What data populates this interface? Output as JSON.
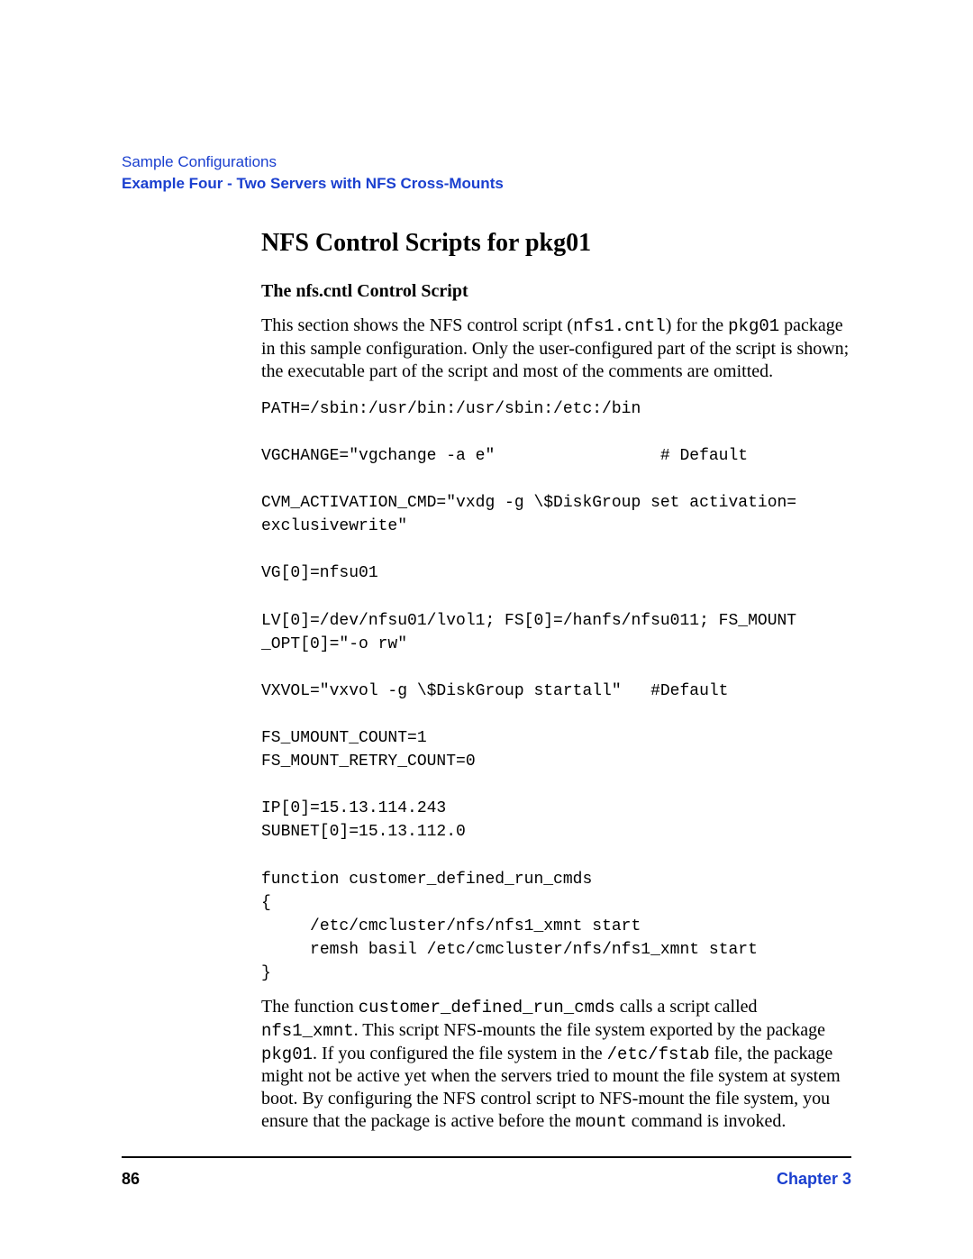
{
  "header": {
    "breadcrumb": "Sample Configurations",
    "title": "Example Four - Two Servers with NFS Cross-Mounts"
  },
  "section": {
    "heading": "NFS Control Scripts for pkg01",
    "subheading": "The nfs.cntl Control Script",
    "intro_pre": "This section shows the NFS control script (",
    "intro_code1": "nfs1.cntl",
    "intro_mid": ") for the ",
    "intro_code2": "pkg01",
    "intro_post": " package in this sample configuration. Only the user-configured part of the script is shown; the executable part of the script and most of the comments are omitted."
  },
  "code": "PATH=/sbin:/usr/bin:/usr/sbin:/etc:/bin\n\nVGCHANGE=\"vgchange -a e\"                 # Default\n\nCVM_ACTIVATION_CMD=\"vxdg -g \\$DiskGroup set activation=\nexclusivewrite\"\n\nVG[0]=nfsu01\n\nLV[0]=/dev/nfsu01/lvol1; FS[0]=/hanfs/nfsu011; FS_MOUNT\n_OPT[0]=\"-o rw\"\n\nVXVOL=\"vxvol -g \\$DiskGroup startall\"   #Default\n\nFS_UMOUNT_COUNT=1\nFS_MOUNT_RETRY_COUNT=0\n\nIP[0]=15.13.114.243\nSUBNET[0]=15.13.112.0\n\nfunction customer_defined_run_cmds\n{\n     /etc/cmcluster/nfs/nfs1_xmnt start\n     remsh basil /etc/cmcluster/nfs/nfs1_xmnt start\n}",
  "closing": {
    "p1_pre": "The function ",
    "p1_code1": "customer_defined_run_cmds",
    "p1_mid1": " calls a script called ",
    "p1_code2": "nfs1_xmnt",
    "p1_mid2": ". This script NFS-mounts the file system exported by the package ",
    "p1_code3": "pkg01",
    "p1_mid3": ". If you configured the file system in the ",
    "p1_code4": "/etc/fstab",
    "p1_mid4": " file, the package might not be active yet when the servers tried to mount the file system at system boot. By configuring the NFS control script to NFS-mount the file system, you ensure that the package is active before the ",
    "p1_code5": "mount",
    "p1_post": " command is invoked."
  },
  "footer": {
    "page": "86",
    "chapter": "Chapter 3"
  }
}
